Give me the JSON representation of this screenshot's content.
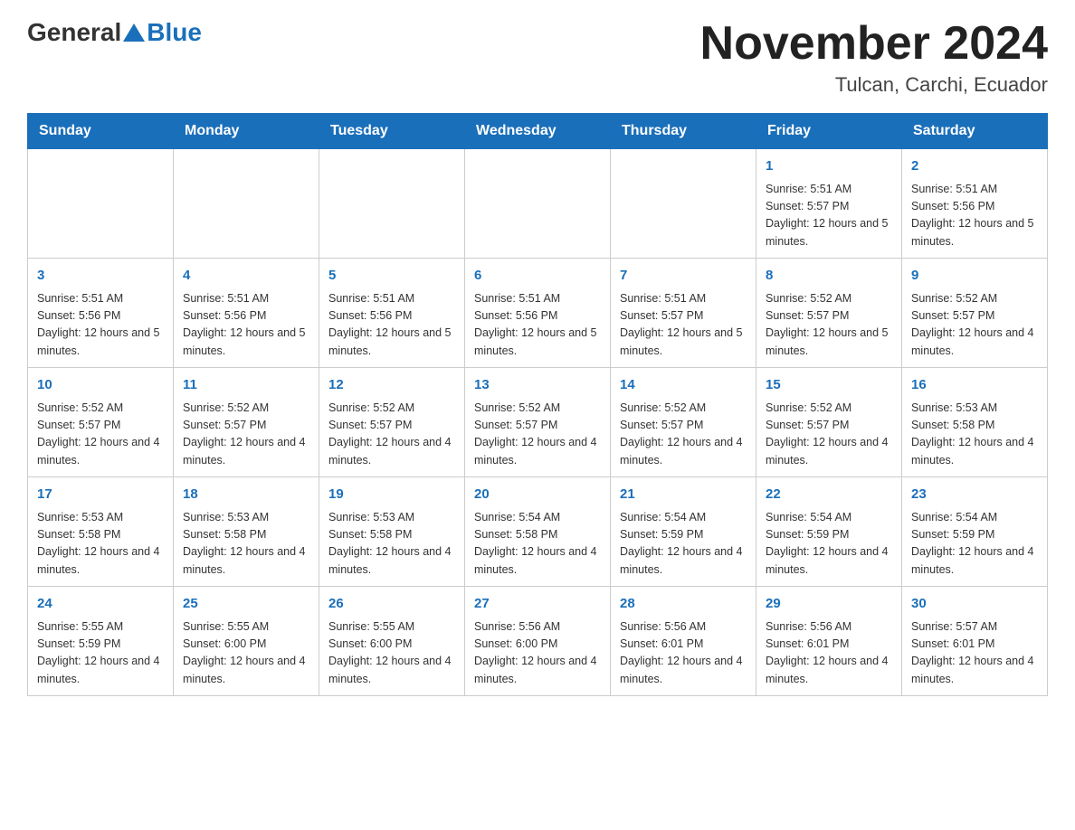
{
  "header": {
    "logo": {
      "general_text": "General",
      "blue_text": "Blue"
    },
    "title": "November 2024",
    "location": "Tulcan, Carchi, Ecuador"
  },
  "days_of_week": [
    "Sunday",
    "Monday",
    "Tuesday",
    "Wednesday",
    "Thursday",
    "Friday",
    "Saturday"
  ],
  "weeks": [
    [
      {
        "day": "",
        "sunrise": "",
        "sunset": "",
        "daylight": ""
      },
      {
        "day": "",
        "sunrise": "",
        "sunset": "",
        "daylight": ""
      },
      {
        "day": "",
        "sunrise": "",
        "sunset": "",
        "daylight": ""
      },
      {
        "day": "",
        "sunrise": "",
        "sunset": "",
        "daylight": ""
      },
      {
        "day": "",
        "sunrise": "",
        "sunset": "",
        "daylight": ""
      },
      {
        "day": "1",
        "sunrise": "Sunrise: 5:51 AM",
        "sunset": "Sunset: 5:57 PM",
        "daylight": "Daylight: 12 hours and 5 minutes."
      },
      {
        "day": "2",
        "sunrise": "Sunrise: 5:51 AM",
        "sunset": "Sunset: 5:56 PM",
        "daylight": "Daylight: 12 hours and 5 minutes."
      }
    ],
    [
      {
        "day": "3",
        "sunrise": "Sunrise: 5:51 AM",
        "sunset": "Sunset: 5:56 PM",
        "daylight": "Daylight: 12 hours and 5 minutes."
      },
      {
        "day": "4",
        "sunrise": "Sunrise: 5:51 AM",
        "sunset": "Sunset: 5:56 PM",
        "daylight": "Daylight: 12 hours and 5 minutes."
      },
      {
        "day": "5",
        "sunrise": "Sunrise: 5:51 AM",
        "sunset": "Sunset: 5:56 PM",
        "daylight": "Daylight: 12 hours and 5 minutes."
      },
      {
        "day": "6",
        "sunrise": "Sunrise: 5:51 AM",
        "sunset": "Sunset: 5:56 PM",
        "daylight": "Daylight: 12 hours and 5 minutes."
      },
      {
        "day": "7",
        "sunrise": "Sunrise: 5:51 AM",
        "sunset": "Sunset: 5:57 PM",
        "daylight": "Daylight: 12 hours and 5 minutes."
      },
      {
        "day": "8",
        "sunrise": "Sunrise: 5:52 AM",
        "sunset": "Sunset: 5:57 PM",
        "daylight": "Daylight: 12 hours and 5 minutes."
      },
      {
        "day": "9",
        "sunrise": "Sunrise: 5:52 AM",
        "sunset": "Sunset: 5:57 PM",
        "daylight": "Daylight: 12 hours and 4 minutes."
      }
    ],
    [
      {
        "day": "10",
        "sunrise": "Sunrise: 5:52 AM",
        "sunset": "Sunset: 5:57 PM",
        "daylight": "Daylight: 12 hours and 4 minutes."
      },
      {
        "day": "11",
        "sunrise": "Sunrise: 5:52 AM",
        "sunset": "Sunset: 5:57 PM",
        "daylight": "Daylight: 12 hours and 4 minutes."
      },
      {
        "day": "12",
        "sunrise": "Sunrise: 5:52 AM",
        "sunset": "Sunset: 5:57 PM",
        "daylight": "Daylight: 12 hours and 4 minutes."
      },
      {
        "day": "13",
        "sunrise": "Sunrise: 5:52 AM",
        "sunset": "Sunset: 5:57 PM",
        "daylight": "Daylight: 12 hours and 4 minutes."
      },
      {
        "day": "14",
        "sunrise": "Sunrise: 5:52 AM",
        "sunset": "Sunset: 5:57 PM",
        "daylight": "Daylight: 12 hours and 4 minutes."
      },
      {
        "day": "15",
        "sunrise": "Sunrise: 5:52 AM",
        "sunset": "Sunset: 5:57 PM",
        "daylight": "Daylight: 12 hours and 4 minutes."
      },
      {
        "day": "16",
        "sunrise": "Sunrise: 5:53 AM",
        "sunset": "Sunset: 5:58 PM",
        "daylight": "Daylight: 12 hours and 4 minutes."
      }
    ],
    [
      {
        "day": "17",
        "sunrise": "Sunrise: 5:53 AM",
        "sunset": "Sunset: 5:58 PM",
        "daylight": "Daylight: 12 hours and 4 minutes."
      },
      {
        "day": "18",
        "sunrise": "Sunrise: 5:53 AM",
        "sunset": "Sunset: 5:58 PM",
        "daylight": "Daylight: 12 hours and 4 minutes."
      },
      {
        "day": "19",
        "sunrise": "Sunrise: 5:53 AM",
        "sunset": "Sunset: 5:58 PM",
        "daylight": "Daylight: 12 hours and 4 minutes."
      },
      {
        "day": "20",
        "sunrise": "Sunrise: 5:54 AM",
        "sunset": "Sunset: 5:58 PM",
        "daylight": "Daylight: 12 hours and 4 minutes."
      },
      {
        "day": "21",
        "sunrise": "Sunrise: 5:54 AM",
        "sunset": "Sunset: 5:59 PM",
        "daylight": "Daylight: 12 hours and 4 minutes."
      },
      {
        "day": "22",
        "sunrise": "Sunrise: 5:54 AM",
        "sunset": "Sunset: 5:59 PM",
        "daylight": "Daylight: 12 hours and 4 minutes."
      },
      {
        "day": "23",
        "sunrise": "Sunrise: 5:54 AM",
        "sunset": "Sunset: 5:59 PM",
        "daylight": "Daylight: 12 hours and 4 minutes."
      }
    ],
    [
      {
        "day": "24",
        "sunrise": "Sunrise: 5:55 AM",
        "sunset": "Sunset: 5:59 PM",
        "daylight": "Daylight: 12 hours and 4 minutes."
      },
      {
        "day": "25",
        "sunrise": "Sunrise: 5:55 AM",
        "sunset": "Sunset: 6:00 PM",
        "daylight": "Daylight: 12 hours and 4 minutes."
      },
      {
        "day": "26",
        "sunrise": "Sunrise: 5:55 AM",
        "sunset": "Sunset: 6:00 PM",
        "daylight": "Daylight: 12 hours and 4 minutes."
      },
      {
        "day": "27",
        "sunrise": "Sunrise: 5:56 AM",
        "sunset": "Sunset: 6:00 PM",
        "daylight": "Daylight: 12 hours and 4 minutes."
      },
      {
        "day": "28",
        "sunrise": "Sunrise: 5:56 AM",
        "sunset": "Sunset: 6:01 PM",
        "daylight": "Daylight: 12 hours and 4 minutes."
      },
      {
        "day": "29",
        "sunrise": "Sunrise: 5:56 AM",
        "sunset": "Sunset: 6:01 PM",
        "daylight": "Daylight: 12 hours and 4 minutes."
      },
      {
        "day": "30",
        "sunrise": "Sunrise: 5:57 AM",
        "sunset": "Sunset: 6:01 PM",
        "daylight": "Daylight: 12 hours and 4 minutes."
      }
    ]
  ]
}
